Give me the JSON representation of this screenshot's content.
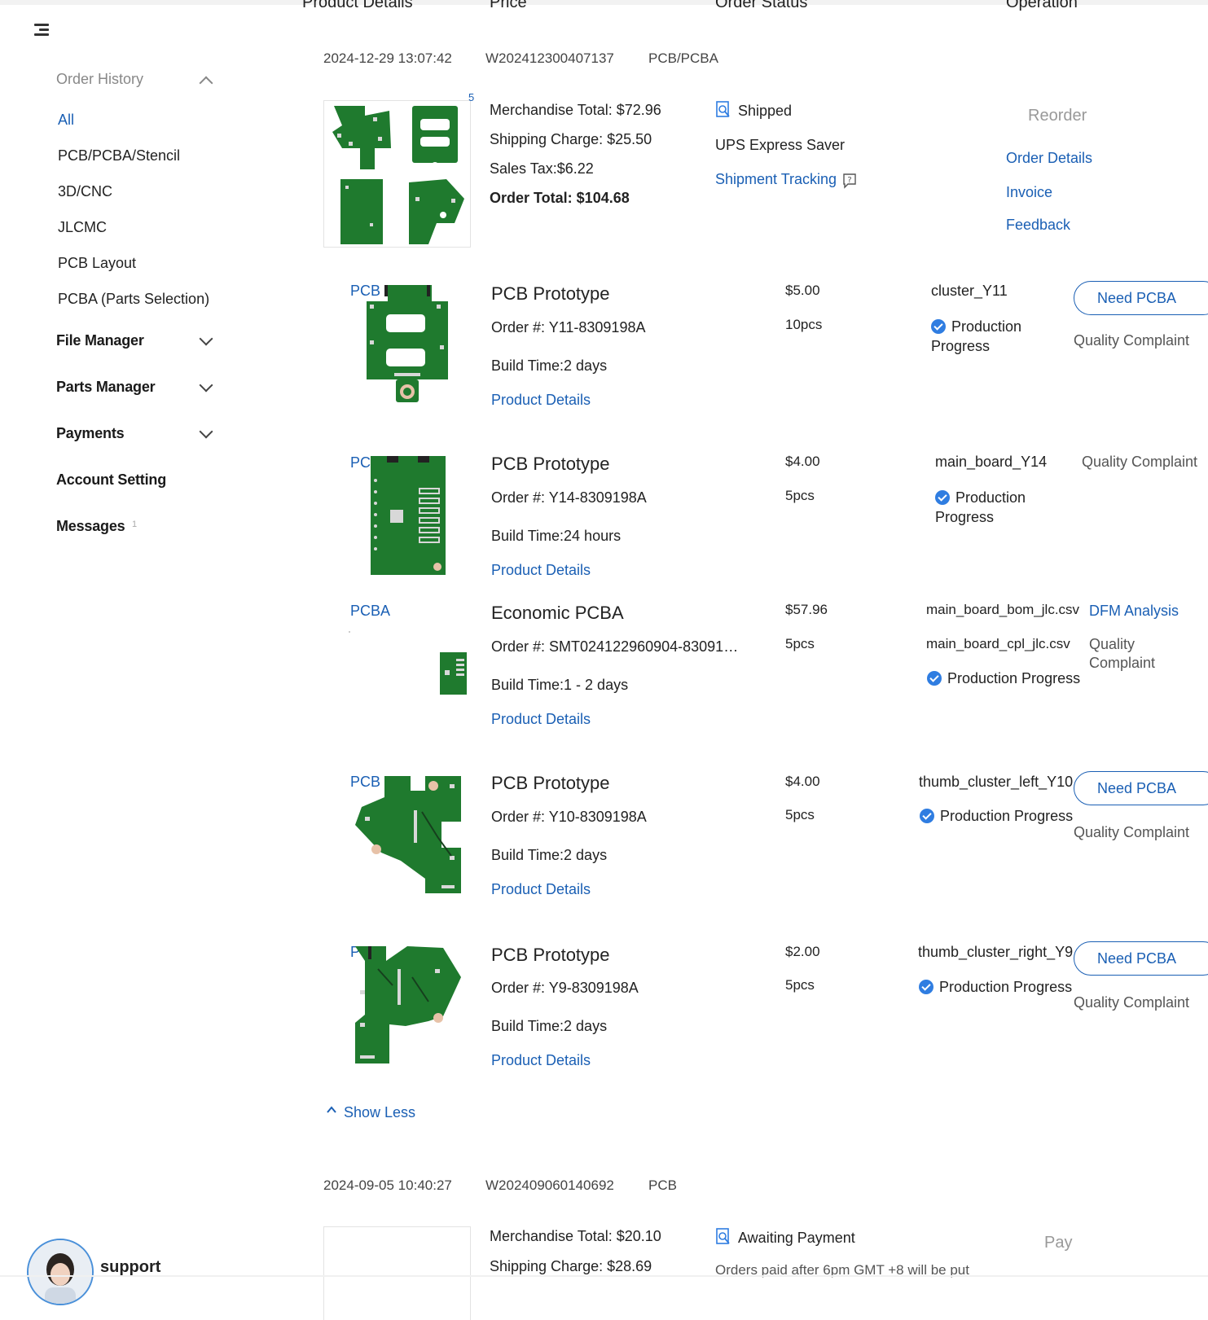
{
  "table_header": {
    "product_details": "Product Details",
    "price": "Price",
    "order_status": "Order Status",
    "operation": "Operation"
  },
  "sidebar": {
    "order_history": "Order History",
    "sub_items": [
      "All",
      "PCB/PCBA/Stencil",
      "3D/CNC",
      "JLCMC",
      "PCB Layout",
      "PCBA (Parts Selection)"
    ],
    "sections": [
      "File Manager",
      "Parts Manager",
      "Payments",
      "Account Setting",
      "Messages"
    ],
    "messages_count": "1",
    "support_label": "support"
  },
  "order1": {
    "date": "2024-12-29 13:07:42",
    "number": "W202412300407137",
    "type": "PCB/PCBA",
    "image_count": "5",
    "merch_total": "Merchandise Total: $72.96",
    "shipping": "Shipping Charge: $25.50",
    "tax": "Sales Tax:$6.22",
    "total": "Order Total: $104.68",
    "status": "Shipped",
    "carrier": "UPS Express Saver",
    "tracking": "Shipment Tracking",
    "reorder": "Reorder",
    "order_details": "Order Details",
    "invoice": "Invoice",
    "feedback": "Feedback",
    "show_less": "Show Less",
    "items": [
      {
        "tag": "PCB",
        "title": "PCB Prototype",
        "order_no": "Order #: Y11-8309198A",
        "build": "Build Time:2 days",
        "details": "Product Details",
        "price": "$5.00",
        "qty": "10pcs",
        "file": "cluster_Y11",
        "status": "Production Progress",
        "btn": "Need PCBA",
        "complaint": "Quality Complaint"
      },
      {
        "tag": "PCB",
        "title": "PCB Prototype",
        "order_no": "Order #: Y14-8309198A",
        "build": "Build Time:24 hours",
        "details": "Product Details",
        "price": "$4.00",
        "qty": "5pcs",
        "file": "main_board_Y14",
        "status": "Production Progress",
        "complaint": "Quality Complaint"
      },
      {
        "tag": "PCBA",
        "title": "Economic PCBA",
        "order_no": "Order #: SMT024122960904-83091…",
        "build": "Build Time:1 - 2 days",
        "details": "Product Details",
        "price": "$57.96",
        "qty": "5pcs",
        "file": "main_board_bom_jlc.csv",
        "file2": "main_board_cpl_jlc.csv",
        "status": "Production Progress",
        "dfm": "DFM Analysis",
        "complaint1": "Quality",
        "complaint2": "Complaint"
      },
      {
        "tag": "PCB",
        "title": "PCB Prototype",
        "order_no": "Order #: Y10-8309198A",
        "build": "Build Time:2 days",
        "details": "Product Details",
        "price": "$4.00",
        "qty": "5pcs",
        "file": "thumb_cluster_left_Y10",
        "status": "Production Progress",
        "btn": "Need PCBA",
        "complaint": "Quality Complaint"
      },
      {
        "tag": "PCB",
        "title": "PCB Prototype",
        "order_no": "Order #: Y9-8309198A",
        "build": "Build Time:2 days",
        "details": "Product Details",
        "price": "$2.00",
        "qty": "5pcs",
        "file": "thumb_cluster_right_Y9",
        "status": "Production Progress",
        "btn": "Need PCBA",
        "complaint": "Quality Complaint"
      }
    ]
  },
  "order2": {
    "date": "2024-09-05 10:40:27",
    "number": "W202409060140692",
    "type": "PCB",
    "merch_total": "Merchandise Total: $20.10",
    "shipping": "Shipping Charge: $28.69",
    "status": "Awaiting Payment",
    "note": "Orders paid after 6pm GMT +8 will be put",
    "pay": "Pay"
  },
  "colors": {
    "link": "#1a5fb4",
    "pcb_green": "#1f7a2e",
    "check_blue": "#2f7de1"
  }
}
